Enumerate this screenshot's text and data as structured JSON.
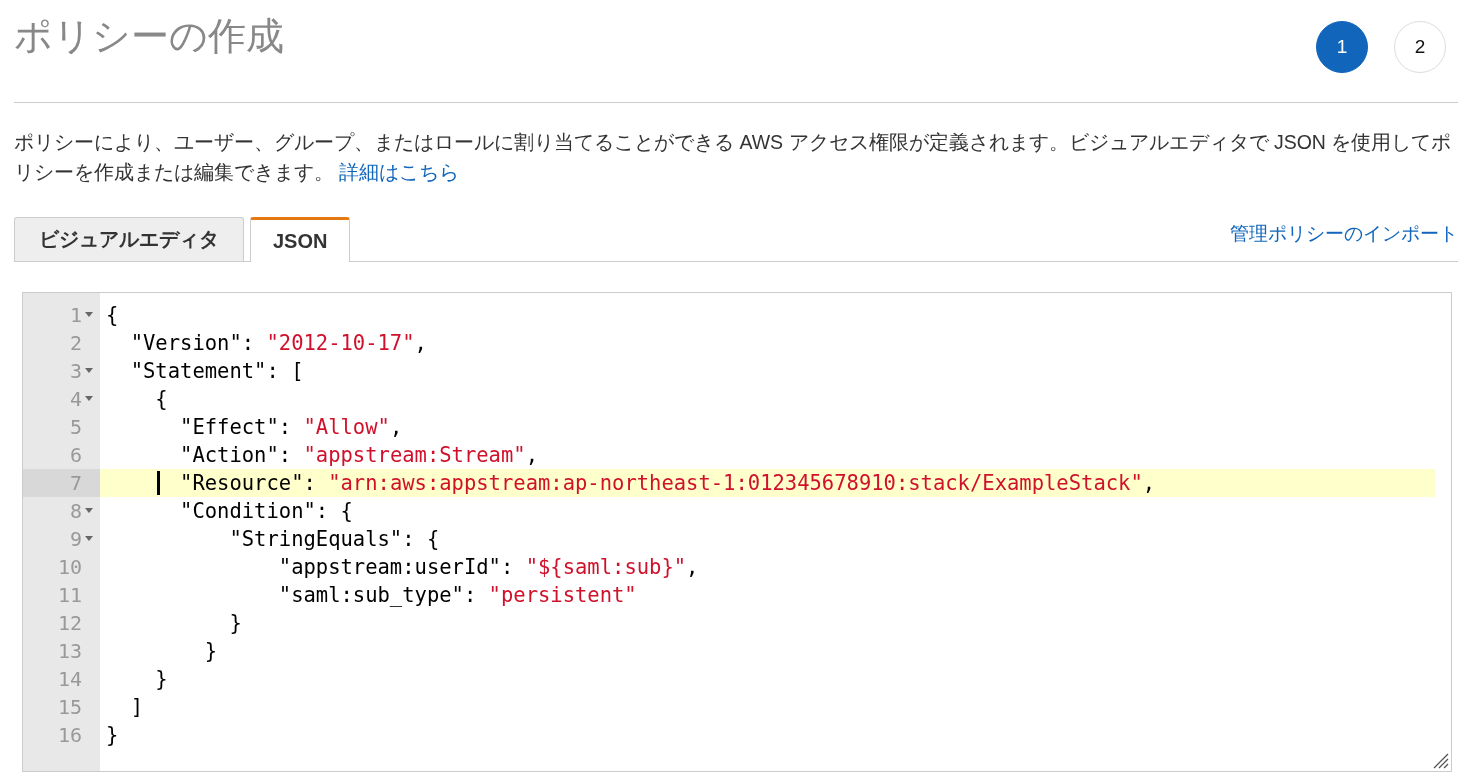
{
  "title": "ポリシーの作成",
  "steps": [
    {
      "label": "1",
      "selected": true
    },
    {
      "label": "2",
      "selected": false
    }
  ],
  "description": {
    "text": "ポリシーにより、ユーザー、グループ、またはロールに割り当てることができる AWS アクセス権限が定義されます。ビジュアルエディタで JSON を使用してポリシーを作成または編集できます。",
    "link": "詳細はこちら"
  },
  "tabs": [
    {
      "label": "ビジュアルエディタ",
      "selected": false
    },
    {
      "label": "JSON",
      "selected": true
    }
  ],
  "import_link": "管理ポリシーのインポート",
  "editor": {
    "lines": [
      {
        "number": "1",
        "foldable": true,
        "highlighted": false,
        "cursor": false,
        "parts": [
          {
            "kind": "plain",
            "text": "{"
          }
        ]
      },
      {
        "number": "2",
        "foldable": false,
        "highlighted": false,
        "cursor": false,
        "parts": [
          {
            "kind": "plain",
            "text": "  \"Version\": "
          },
          {
            "kind": "string",
            "text": "\"2012-10-17\""
          },
          {
            "kind": "plain",
            "text": ","
          }
        ]
      },
      {
        "number": "3",
        "foldable": true,
        "highlighted": false,
        "cursor": false,
        "parts": [
          {
            "kind": "plain",
            "text": "  \"Statement\": ["
          }
        ]
      },
      {
        "number": "4",
        "foldable": true,
        "highlighted": false,
        "cursor": false,
        "parts": [
          {
            "kind": "plain",
            "text": "    {"
          }
        ]
      },
      {
        "number": "5",
        "foldable": false,
        "highlighted": false,
        "cursor": false,
        "parts": [
          {
            "kind": "plain",
            "text": "      \"Effect\": "
          },
          {
            "kind": "string",
            "text": "\"Allow\""
          },
          {
            "kind": "plain",
            "text": ","
          }
        ]
      },
      {
        "number": "6",
        "foldable": false,
        "highlighted": false,
        "cursor": false,
        "parts": [
          {
            "kind": "plain",
            "text": "      \"Action\": "
          },
          {
            "kind": "string",
            "text": "\"appstream:Stream\""
          },
          {
            "kind": "plain",
            "text": ","
          }
        ]
      },
      {
        "number": "7",
        "foldable": false,
        "highlighted": true,
        "cursor": true,
        "parts": [
          {
            "kind": "plain",
            "text": "      \"Resource\": "
          },
          {
            "kind": "string",
            "text": "\"arn:aws:appstream:ap-northeast-1:012345678910:stack/ExampleStack\""
          },
          {
            "kind": "plain",
            "text": ","
          }
        ]
      },
      {
        "number": "8",
        "foldable": true,
        "highlighted": false,
        "cursor": false,
        "parts": [
          {
            "kind": "plain",
            "text": "      \"Condition\": {"
          }
        ]
      },
      {
        "number": "9",
        "foldable": true,
        "highlighted": false,
        "cursor": false,
        "parts": [
          {
            "kind": "plain",
            "text": "          \"StringEquals\": {"
          }
        ]
      },
      {
        "number": "10",
        "foldable": false,
        "highlighted": false,
        "cursor": false,
        "parts": [
          {
            "kind": "plain",
            "text": "              \"appstream:userId\": "
          },
          {
            "kind": "string",
            "text": "\"${saml:sub}\""
          },
          {
            "kind": "plain",
            "text": ","
          }
        ]
      },
      {
        "number": "11",
        "foldable": false,
        "highlighted": false,
        "cursor": false,
        "parts": [
          {
            "kind": "plain",
            "text": "              \"saml:sub_type\": "
          },
          {
            "kind": "string",
            "text": "\"persistent\""
          }
        ]
      },
      {
        "number": "12",
        "foldable": false,
        "highlighted": false,
        "cursor": false,
        "parts": [
          {
            "kind": "plain",
            "text": "          }"
          }
        ]
      },
      {
        "number": "13",
        "foldable": false,
        "highlighted": false,
        "cursor": false,
        "parts": [
          {
            "kind": "plain",
            "text": "        }"
          }
        ]
      },
      {
        "number": "14",
        "foldable": false,
        "highlighted": false,
        "cursor": false,
        "parts": [
          {
            "kind": "plain",
            "text": "    }"
          }
        ]
      },
      {
        "number": "15",
        "foldable": false,
        "highlighted": false,
        "cursor": false,
        "parts": [
          {
            "kind": "plain",
            "text": "  ]"
          }
        ]
      },
      {
        "number": "16",
        "foldable": false,
        "highlighted": false,
        "cursor": false,
        "parts": [
          {
            "kind": "plain",
            "text": "}"
          }
        ]
      }
    ]
  }
}
